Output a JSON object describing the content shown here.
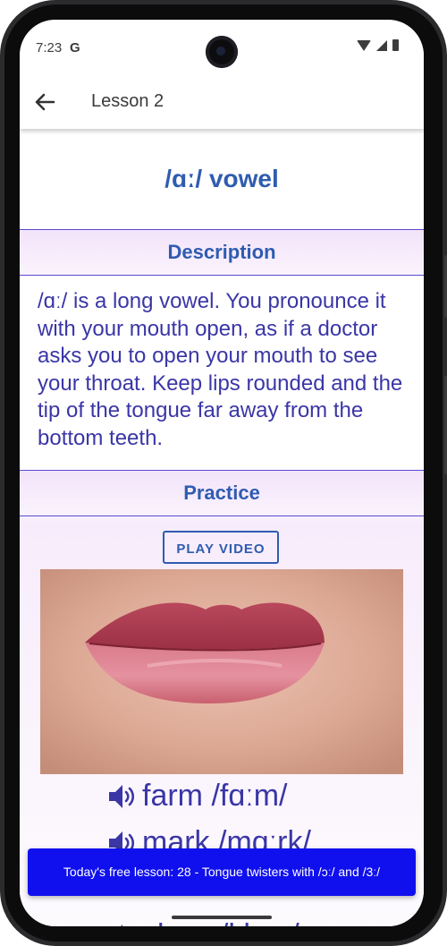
{
  "status_bar": {
    "time": "7:23",
    "g_logo": "G"
  },
  "app_bar": {
    "title": "Lesson 2"
  },
  "lesson": {
    "heading": "/ɑː/ vowel",
    "description_header": "Description",
    "description_text": "/ɑː/ is a long vowel. You pronounce it with your mouth open, as if a doctor asks you to open your mouth to see your throat. Keep lips rounded and the tip of the tongue far away from the bottom teeth.",
    "practice_header": "Practice",
    "play_video_label": "PLAY VIDEO",
    "words": [
      {
        "text": "farm /fɑːm/"
      },
      {
        "text": "mark /mɑːrk/"
      },
      {
        "text": "class /klɑːs/"
      }
    ]
  },
  "banner": {
    "text": "Today's free lesson: 28 - Tongue twisters with /ɔː/ and /3ː/"
  },
  "colors": {
    "accent": "#2f5cb0",
    "text_purple": "#3a36a6",
    "section_bg": "#f3e3fa",
    "banner_bg": "#1010ee"
  },
  "icons": [
    "back-arrow-icon",
    "speaker-icon",
    "wifi-icon",
    "signal-icon",
    "battery-icon"
  ]
}
